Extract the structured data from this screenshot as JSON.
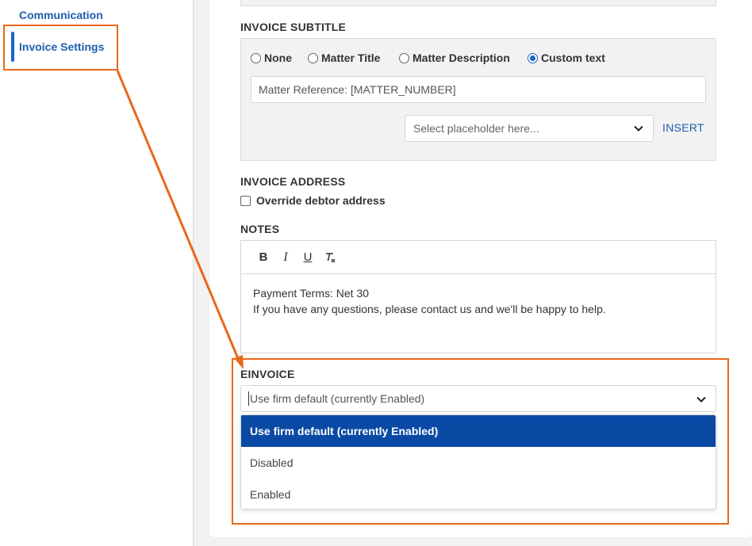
{
  "sidebar": {
    "items": [
      {
        "label": "Communication"
      },
      {
        "label": "Invoice Settings"
      }
    ]
  },
  "invoice_subtitle": {
    "label": "INVOICE SUBTITLE",
    "options": [
      {
        "label": "None",
        "checked": false
      },
      {
        "label": "Matter Title",
        "checked": false
      },
      {
        "label": "Matter Description",
        "checked": false
      },
      {
        "label": "Custom text",
        "checked": true
      }
    ],
    "custom_value": "Matter Reference: [MATTER_NUMBER]",
    "placeholder_select": "Select placeholder here...",
    "insert_label": "INSERT"
  },
  "invoice_address": {
    "label": "INVOICE ADDRESS",
    "override_label": "Override debtor address"
  },
  "notes": {
    "label": "NOTES",
    "toolbar": {
      "bold": "B",
      "italic": "I",
      "underline": "U",
      "clear": "T"
    },
    "lines": [
      "Payment Terms: Net 30",
      "If you have any questions, please contact us and we'll be happy to help."
    ]
  },
  "einvoice": {
    "label": "EINVOICE",
    "selected": "Use firm default (currently Enabled)",
    "options": [
      "Use firm default (currently Enabled)",
      "Disabled",
      "Enabled"
    ]
  },
  "colors": {
    "accent": "#1b63c7",
    "link": "#1d5fae",
    "annotation": "#e8691a",
    "selected_option": "#0a4aa5"
  }
}
